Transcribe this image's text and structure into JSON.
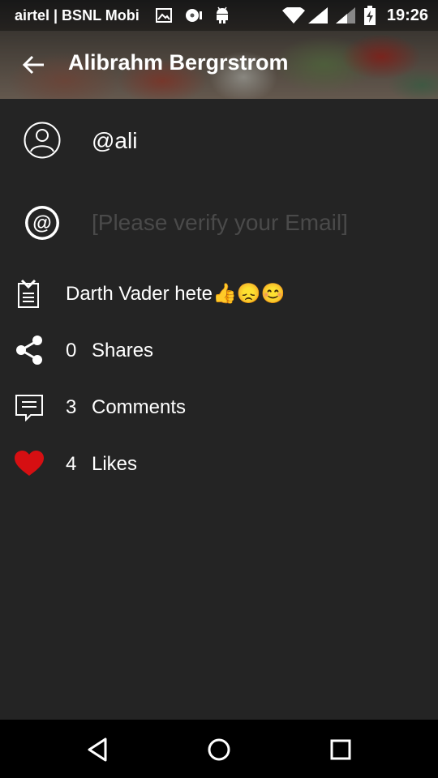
{
  "status_bar": {
    "carrier": "airtel | BSNL Mobi",
    "time": "19:26",
    "icons": [
      "image-icon",
      "media-icon",
      "android-icon",
      "wifi-icon",
      "signal-icon",
      "signal-icon-2",
      "battery-charging-icon"
    ]
  },
  "header": {
    "title": "Alibrahm Bergrstrom",
    "back_icon": "arrow-left-icon"
  },
  "profile": {
    "username": "@ali",
    "email_placeholder": "[Please verify your Email]",
    "status": "Darth Vader hete👍😞😊"
  },
  "stats": {
    "shares_count": "0",
    "shares_label": "Shares",
    "comments_count": "3",
    "comments_label": "Comments",
    "likes_count": "4",
    "likes_label": "Likes"
  },
  "colors": {
    "background": "#242424",
    "heart": "#d60f12",
    "placeholder": "#4a4a4a"
  }
}
